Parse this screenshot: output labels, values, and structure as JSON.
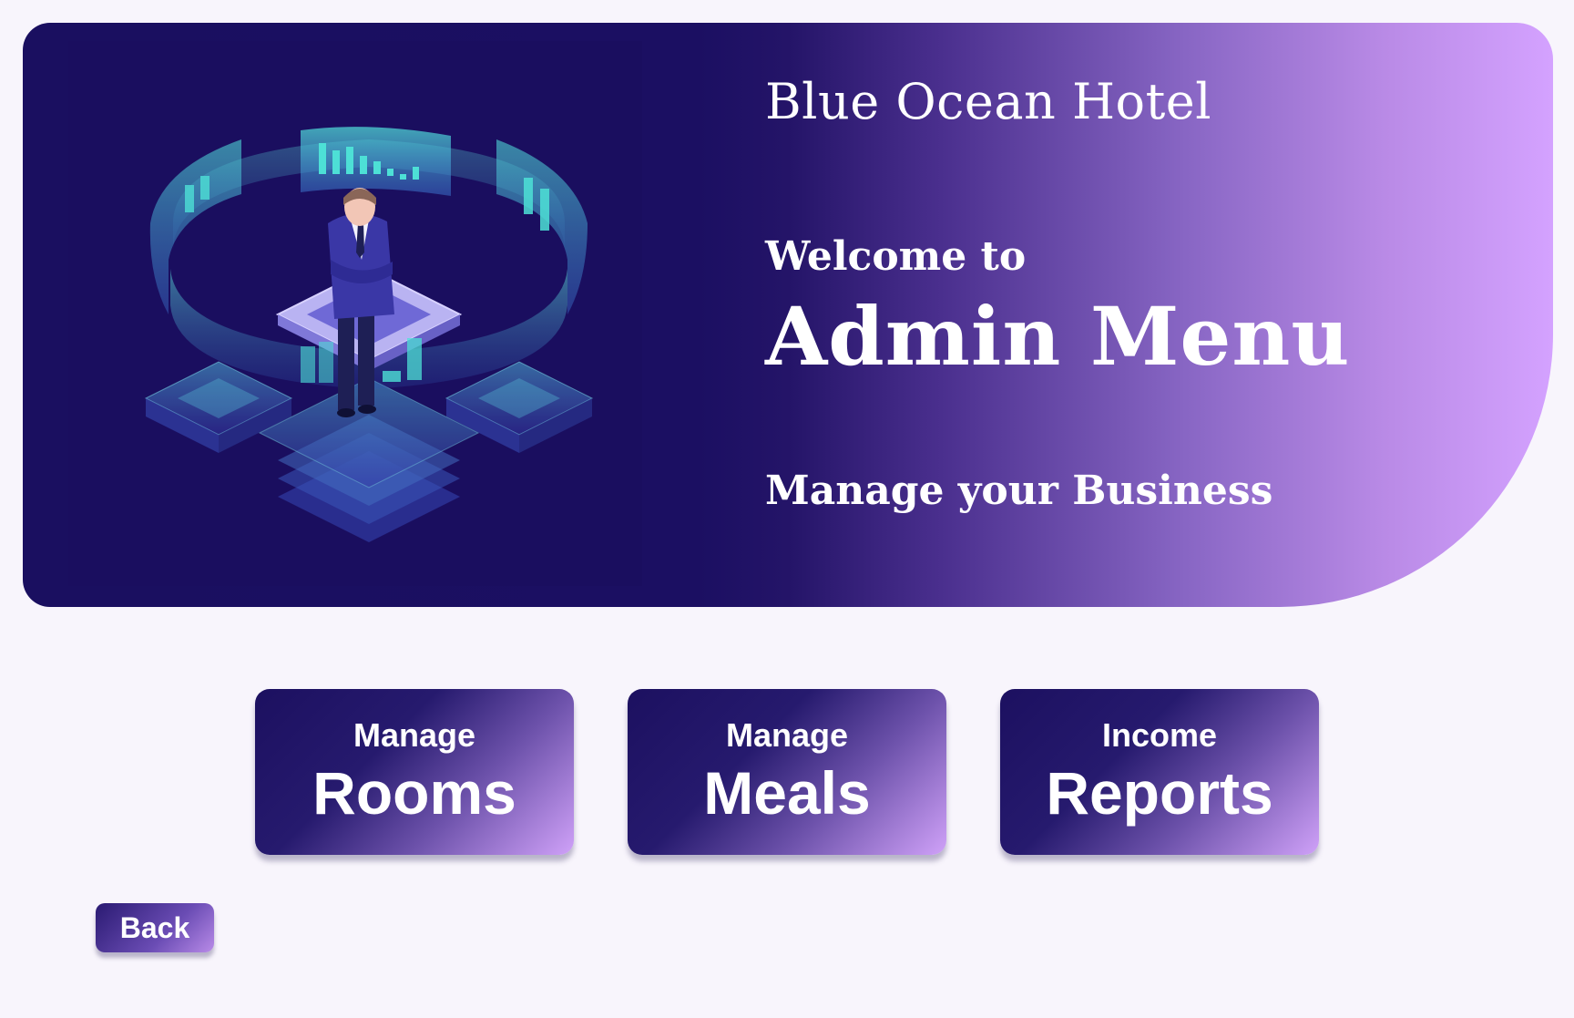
{
  "hero": {
    "hotel_name": "Blue Ocean Hotel",
    "welcome": "Welcome to",
    "title": "Admin Menu",
    "tagline": "Manage your Business",
    "illustration": "isometric-businessman-dashboard-illustration"
  },
  "menu": [
    {
      "small": "Manage",
      "big": "Rooms"
    },
    {
      "small": "Manage",
      "big": "Meals"
    },
    {
      "small": "Income",
      "big": "Reports"
    }
  ],
  "back_label": "Back",
  "colors": {
    "background": "#f8f5fc",
    "deep_navy": "#1a0f60",
    "lavender": "#d4a2ff",
    "cyan_accent": "#4de0d6"
  }
}
